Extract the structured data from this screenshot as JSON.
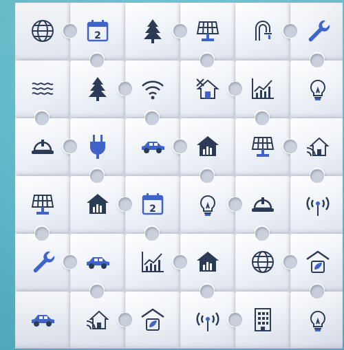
{
  "colors": {
    "frame": "#5bb8c8",
    "icon_blue": "#3f63c9",
    "icon_dark": "#2b3a55",
    "piece": "#f3f5f9"
  },
  "grid": [
    [
      "globe-icon",
      "calendar-icon",
      "tree-icon",
      "solar-panel-icon",
      "faucet-icon",
      "wrench-icon"
    ],
    [
      "water-waves-icon",
      "tree-icon",
      "wifi-icon",
      "house-tools-icon",
      "bar-chart-icon",
      "lightbulb-icon"
    ],
    [
      "hard-hat-icon",
      "plug-icon",
      "car-icon",
      "house-stats-icon",
      "solar-panel-icon",
      "smart-home-icon"
    ],
    [
      "solar-panel-icon",
      "house-stats-icon",
      "calendar-icon",
      "lightbulb-icon",
      "hard-hat-icon",
      "antenna-icon"
    ],
    [
      "wrench-icon",
      "car-icon",
      "bar-chart-icon",
      "house-stats-icon",
      "globe-icon",
      "eco-house-icon"
    ],
    [
      "car-icon",
      "smart-home-icon",
      "eco-house-icon",
      "antenna-icon",
      "building-icon",
      "lightbulb-icon"
    ]
  ],
  "calendar_number": "2"
}
